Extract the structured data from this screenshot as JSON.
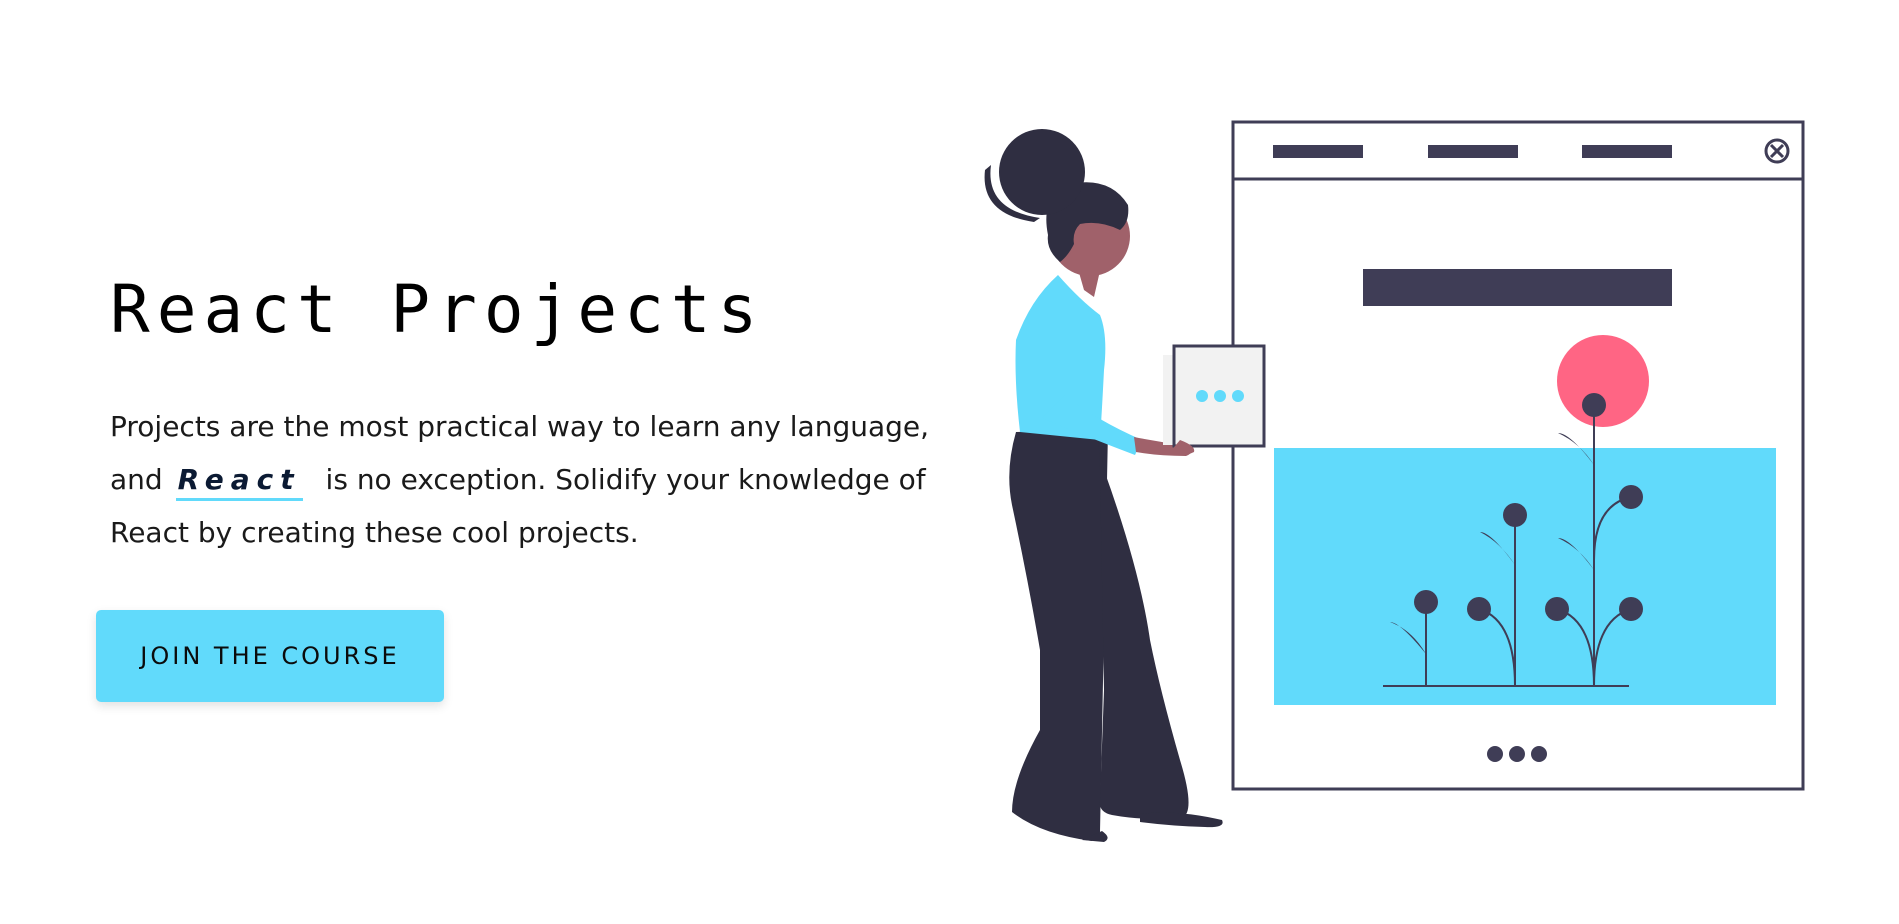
{
  "hero": {
    "title": "React Projects",
    "description_before": "Projects are the most practical way to learn any language, and",
    "highlight": "React",
    "description_after": "is no exception. Solidify your knowledge of React by creating these cool projects.",
    "cta_label": "JOIN THE COURSE"
  },
  "colors": {
    "accent": "#61dafb",
    "dark": "#3f3d56",
    "flower": "#ff6584",
    "skin": "#a0616a",
    "hair": "#2f2e41"
  },
  "icons": {
    "close": "close-circle-icon",
    "more": "ellipsis-icon"
  }
}
